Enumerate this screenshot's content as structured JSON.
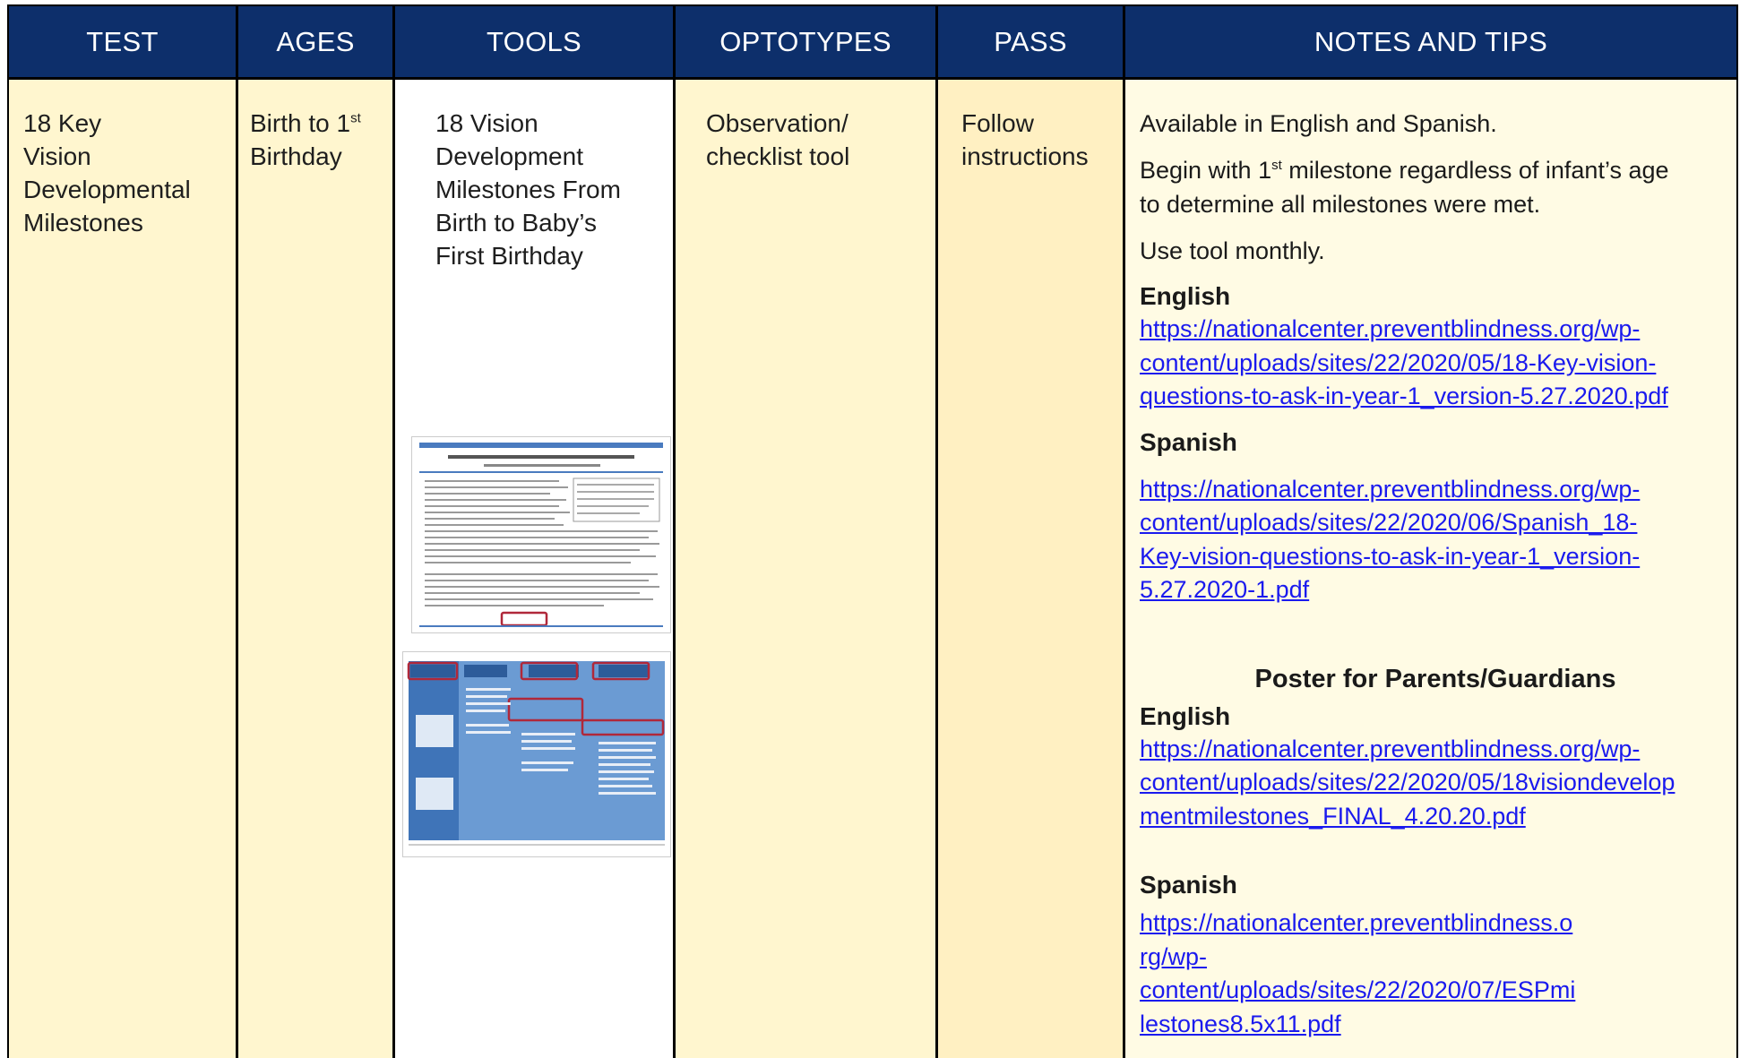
{
  "headers": [
    "TEST",
    "AGES",
    "TOOLS",
    "OPTOTYPES",
    "PASS",
    "NOTES AND TIPS"
  ],
  "row": {
    "test": [
      "18 Key",
      "Vision",
      "Developmental",
      "Milestones"
    ],
    "ages": {
      "line1_pre": "Birth to 1",
      "line1_sup": "st",
      "line2": "Birthday"
    },
    "tools": [
      "18 Vision",
      "Development",
      "Milestones From",
      "Birth to Baby’s",
      "First Birthday"
    ],
    "optotypes": [
      "Observation/",
      "checklist tool"
    ],
    "pass": [
      "Follow",
      "instructions"
    ],
    "notes": {
      "available": "Available in English and Spanish.",
      "begin_pre": "Begin with 1",
      "begin_sup": "st",
      "begin_post": " milestone regardless of infant’s age",
      "begin_line2": "to determine all milestones were met.",
      "use_monthly": "Use tool monthly.",
      "english_label": "English",
      "english_link": [
        "https://nationalcenter.preventblindness.org/wp-",
        "content/uploads/sites/22/2020/05/18-Key-vision-",
        "questions-to-ask-in-year-1_version-5.27.2020.pdf"
      ],
      "spanish_label": "Spanish",
      "spanish_link": [
        "https://nationalcenter.preventblindness.org/wp-",
        "content/uploads/sites/22/2020/06/Spanish_18-",
        "Key-vision-questions-to-ask-in-year-1_version-",
        "5.27.2020-1.pdf"
      ],
      "poster_heading": "Poster for Parents/Guardians",
      "poster_english_label": "English",
      "poster_english_link": [
        "https://nationalcenter.preventblindness.org/wp-",
        "content/uploads/sites/22/2020/05/18visiondevelop",
        "mentmilestones_FINAL_4.20.20.pdf"
      ],
      "poster_spanish_label": "Spanish",
      "poster_spanish_link": [
        "https://nationalcenter.preventblindness.o",
        "rg/wp-",
        "content/uploads/sites/22/2020/07/ESPmi",
        "lestones8.5x11.pdf"
      ]
    }
  },
  "colors": {
    "header_bg": "#0d2f6b",
    "pale_yellow": "#fff6cf",
    "link": "#1a1aee",
    "thumb_blue": "#5b8ec9"
  }
}
